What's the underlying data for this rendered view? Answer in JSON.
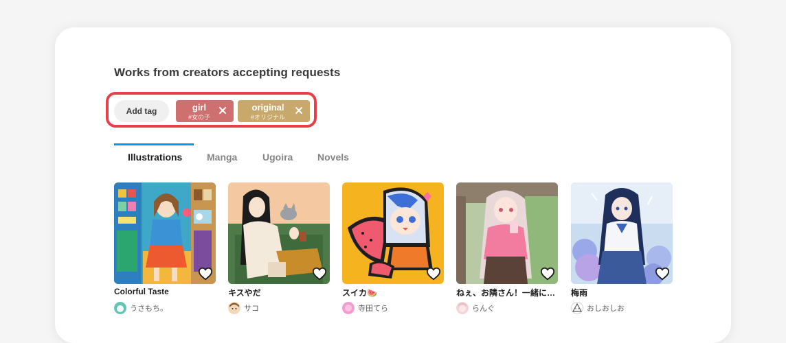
{
  "section": {
    "title": "Works from creators accepting requests"
  },
  "tags": {
    "add_label": "Add tag",
    "items": [
      {
        "name": "girl",
        "translation": "#女の子",
        "color": "#cf7070"
      },
      {
        "name": "original",
        "translation": "#オリジナル",
        "color": "#c9a86b"
      }
    ]
  },
  "tabs": [
    {
      "label": "Illustrations",
      "active": true
    },
    {
      "label": "Manga",
      "active": false
    },
    {
      "label": "Ugoira",
      "active": false
    },
    {
      "label": "Novels",
      "active": false
    }
  ],
  "works": [
    {
      "title": "Colorful Taste",
      "author": "うさもち。"
    },
    {
      "title": "キスやだ",
      "author": "サコ"
    },
    {
      "title": "スイカ🍉",
      "author": "寺田てら"
    },
    {
      "title": "ねぇ、お隣さん！一緒に買い物行こっ！",
      "author": "らんぐ"
    },
    {
      "title": "梅雨",
      "author": "おしおしお"
    }
  ],
  "colors": {
    "accent": "#0096fa",
    "highlight": "#e8404b"
  }
}
